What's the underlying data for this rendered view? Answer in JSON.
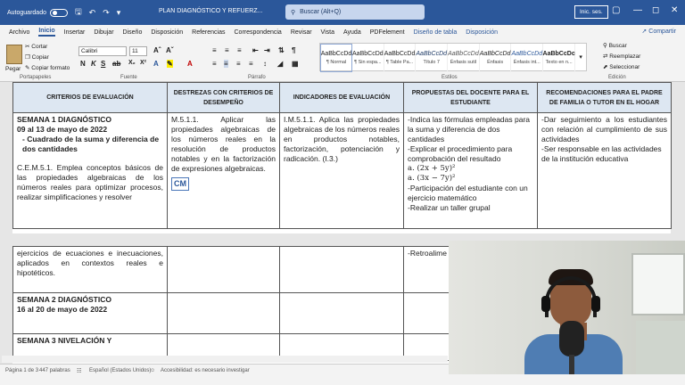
{
  "titlebar": {
    "autosave_label": "Autoguardado",
    "doc_title": "PLAN DIAGNÓSTICO Y REFUERZ...",
    "search_placeholder": "Buscar (Alt+Q)",
    "signin_label": "Inic. ses.",
    "save_icon": "save-icon",
    "undo_icon": "undo-icon",
    "redo_icon": "redo-icon"
  },
  "menu": {
    "items": [
      "Archivo",
      "Inicio",
      "Insertar",
      "Dibujar",
      "Diseño",
      "Disposición",
      "Referencias",
      "Correspondencia",
      "Revisar",
      "Vista",
      "Ayuda",
      "PDFelement",
      "Diseño de tabla",
      "Disposición"
    ],
    "active_index": 1,
    "share_label": "Compartir"
  },
  "ribbon": {
    "clipboard": {
      "paste": "Pegar",
      "cut": "Cortar",
      "copy": "Copiar",
      "format_painter": "Copiar formato",
      "group": "Portapapeles"
    },
    "font": {
      "name": "Calibri",
      "size": "11",
      "group": "Fuente"
    },
    "paragraph": {
      "group": "Párrafo"
    },
    "styles": {
      "group": "Estilos",
      "items": [
        {
          "preview": "AaBbCcDd",
          "name": "¶ Normal"
        },
        {
          "preview": "AaBbCcDd",
          "name": "¶ Sin espa..."
        },
        {
          "preview": "AaBbCcDd",
          "name": "¶ Table Pa..."
        },
        {
          "preview": "AaBbCcDd",
          "name": "Título 7"
        },
        {
          "preview": "AaBbCcDd",
          "name": "Énfasis sutil"
        },
        {
          "preview": "AaBbCcDd",
          "name": "Énfasis"
        },
        {
          "preview": "AaBbCcDd",
          "name": "Énfasis int..."
        },
        {
          "preview": "AaBbCcDc",
          "name": "Texto en n..."
        }
      ]
    },
    "editing": {
      "find": "Buscar",
      "replace": "Reemplazar",
      "select": "Seleccionar",
      "group": "Edición"
    }
  },
  "table": {
    "headers": [
      "CRITERIOS DE EVALUACIÓN",
      "DESTREZAS CON CRITERIOS DE DESEMPEÑO",
      "INDICADORES DE EVALUACIÓN",
      "PROPUESTAS DEL DOCENTE PARA EL ESTUDIANTE",
      "RECOMENDACIONES PARA EL PADRE DE FAMILIA O TUTOR EN EL HOGAR"
    ],
    "row1": {
      "week_title": "SEMANA 1 DIAGNÓSTICO",
      "dates": "09 al 13 de mayo de 2022",
      "topic": "- Cuadrado de la suma y diferencia de dos cantidades",
      "criterion": "C.E.M.5.1. Emplea conceptos básicos de las propiedades algebraicas de los números reales para optimizar procesos, realizar simplificaciones y resolver",
      "skill": "M.5.1.1. Aplicar las propiedades algebraicas de los números reales en la resolución de productos notables y en la factorización de expresiones algebraicas.",
      "cm": "CM",
      "indicator": "I.M.5.1.1. Aplica las propiedades algebraicas de los números reales en productos notables, factorización, potenciación y radicación. (I.3.)",
      "proposals": [
        "-Indica las fórmulas empleadas para la suma y diferencia de dos cantidades",
        "-Explicar el procedimiento para comprobación del resultado",
        "a. (2x + 5y)²",
        "a. (3x − 7y)²",
        "-Participación del estudiante con un ejercicio matemático",
        "-Realizar un taller grupal"
      ],
      "recommendations": [
        "-Dar seguimiento a los estudiantes con relación al cumplimiento de sus actividades",
        "-Ser responsable en las actividades de la institución educativa"
      ]
    },
    "row1_cont": {
      "criterion": "ejercicios de ecuaciones e inecuaciones, aplicados en contextos reales e hipotéticos.",
      "proposal": "-Retroalime"
    },
    "row2": {
      "week_title": "SEMANA 2 DIAGNÓSTICO",
      "dates": "16 al 20 de mayo de 2022"
    },
    "row3": {
      "week_title": "SEMANA 3 NIVELACIÓN Y"
    }
  },
  "status": {
    "page": "Página 1 de 3",
    "words": "447 palabras",
    "language": "Español (Estados Unidos)",
    "accessibility": "Accesibilidad: es necesario investigar"
  }
}
